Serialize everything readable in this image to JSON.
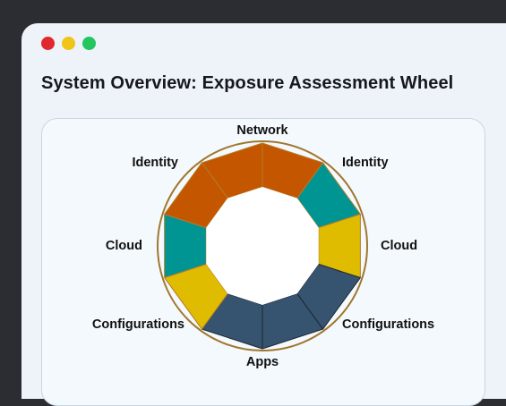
{
  "window": {
    "traffic_lights": [
      "#e0282d",
      "#f0c419",
      "#22c55e"
    ]
  },
  "page_title": "System Overview: Exposure Assessment Wheel",
  "wheel": {
    "segments": [
      {
        "name": "network-left",
        "color": "#c45600"
      },
      {
        "name": "network-right",
        "color": "#c45600"
      },
      {
        "name": "identity-right",
        "color": "#009592"
      },
      {
        "name": "cloud-right",
        "color": "#e0bc00"
      },
      {
        "name": "configurations-right",
        "color": "#36546f"
      },
      {
        "name": "apps-right",
        "color": "#36546f"
      },
      {
        "name": "apps-left",
        "color": "#36546f"
      },
      {
        "name": "configurations-left",
        "color": "#e0bc00"
      },
      {
        "name": "cloud-left",
        "color": "#009592"
      },
      {
        "name": "identity-left",
        "color": "#c45600"
      }
    ],
    "labels": {
      "network": "Network",
      "identity_left": "Identity",
      "identity_right": "Identity",
      "cloud_left": "Cloud",
      "cloud_right": "Cloud",
      "configurations_left": "Configurations",
      "configurations_right": "Configurations",
      "apps": "Apps"
    }
  }
}
